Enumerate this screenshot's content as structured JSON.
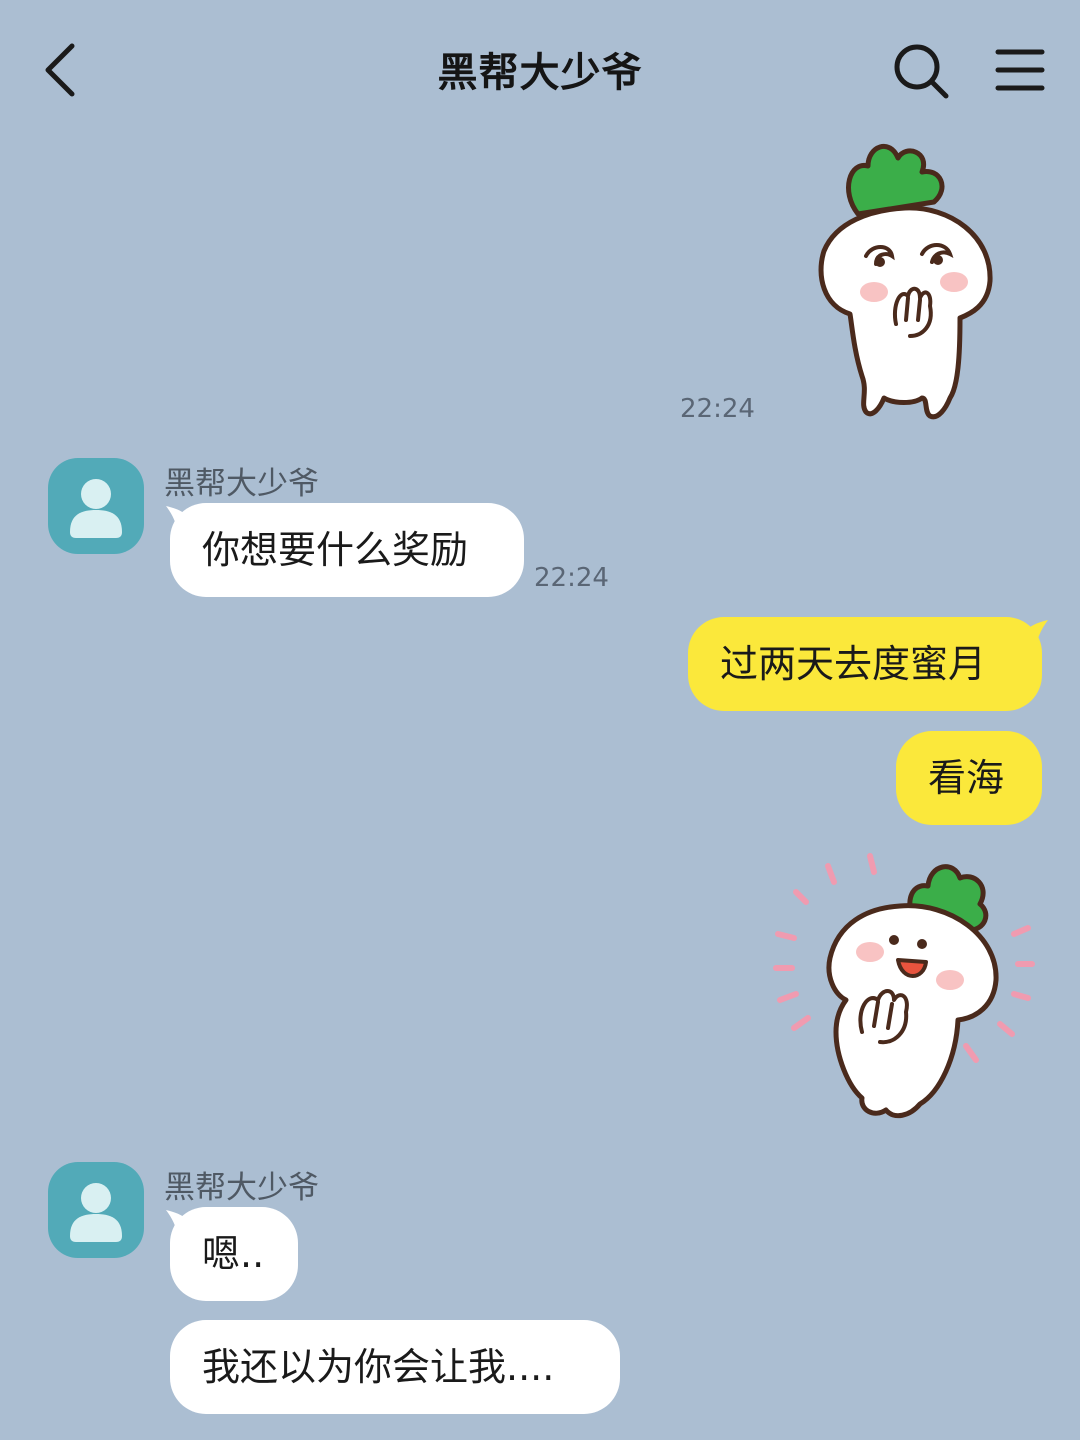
{
  "header": {
    "title": "黑帮大少爷",
    "back_icon": "chevron-left-icon",
    "search_icon": "search-icon",
    "menu_icon": "menu-icon"
  },
  "colors": {
    "background": "#abbed2",
    "incoming_bubble": "#ffffff",
    "outgoing_bubble": "#fbe83b",
    "avatar": "#52aab8"
  },
  "messages": [
    {
      "from": "me",
      "type": "sticker",
      "sticker": "radish-blushing-sticker",
      "time": "22:24"
    },
    {
      "from": "other",
      "sender": "黑帮大少爷",
      "type": "text",
      "text": "你想要什么奖励",
      "time": "22:24"
    },
    {
      "from": "me",
      "type": "text",
      "text": "过两天去度蜜月"
    },
    {
      "from": "me",
      "type": "text",
      "text": "看海"
    },
    {
      "from": "me",
      "type": "sticker",
      "sticker": "radish-excited-sticker"
    },
    {
      "from": "other",
      "sender": "黑帮大少爷",
      "type": "text",
      "text": "嗯.."
    },
    {
      "from": "other",
      "type": "text",
      "text": "我还以为你会让我...."
    }
  ]
}
